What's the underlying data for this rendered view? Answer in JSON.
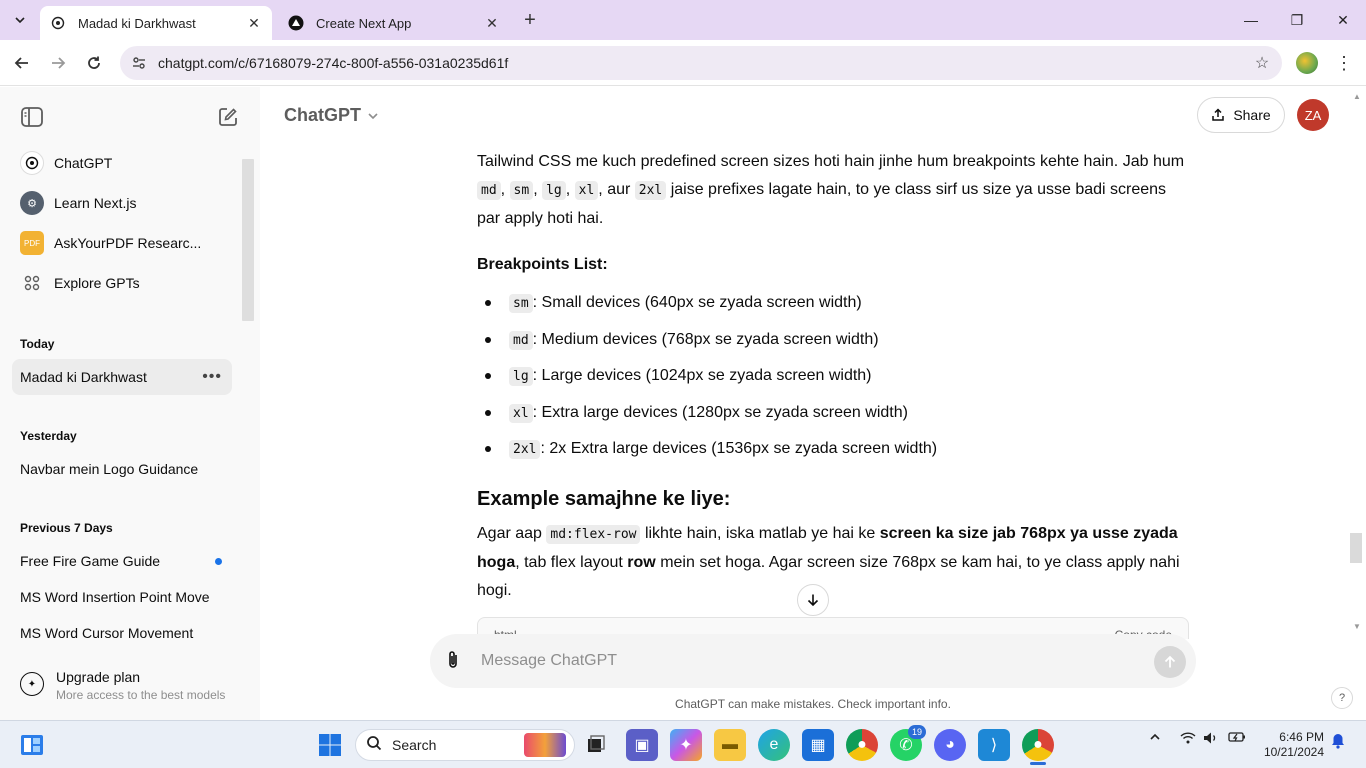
{
  "browser": {
    "tabs": [
      {
        "title": "Madad ki Darkhwast",
        "active": true
      },
      {
        "title": "Create Next App",
        "active": false
      }
    ],
    "url": "chatgpt.com/c/67168079-274c-800f-a556-031a0235d61f"
  },
  "sidebar": {
    "gpts": [
      {
        "label": "ChatGPT",
        "icon": "openai-icon"
      },
      {
        "label": "Learn Next.js",
        "icon": "nextjs-avatar"
      },
      {
        "label": "AskYourPDF Researc...",
        "icon": "askyourpdf-icon"
      },
      {
        "label": "Explore GPTs",
        "icon": "grid-icon"
      }
    ],
    "sections": [
      {
        "title": "Today",
        "items": [
          {
            "label": "Madad ki Darkhwast",
            "active": true
          }
        ]
      },
      {
        "title": "Yesterday",
        "items": [
          {
            "label": "Navbar mein Logo Guidance"
          }
        ]
      },
      {
        "title": "Previous 7 Days",
        "items": [
          {
            "label": "Free Fire Game Guide",
            "unread": true
          },
          {
            "label": "MS Word Insertion Point Move"
          },
          {
            "label": "MS Word Cursor Movement"
          }
        ]
      }
    ],
    "upgrade": {
      "title": "Upgrade plan",
      "subtitle": "More access to the best models"
    }
  },
  "header": {
    "model": "ChatGPT",
    "share_label": "Share",
    "avatar_initials": "ZA"
  },
  "message": {
    "intro_a": "Tailwind CSS me kuch predefined screen sizes hoti hain jinhe hum breakpoints kehte hain. Jab hum",
    "intro_codes": [
      "md",
      "sm",
      "lg",
      "xl",
      "2xl"
    ],
    "intro_aur": "aur",
    "intro_b": "jaise prefixes lagate hain, to ye class sirf us size ya usse badi screens par apply hoti hai.",
    "breakpoints_title": "Breakpoints List:",
    "breakpoints": [
      {
        "code": "sm",
        "text": ": Small devices (640px se zyada screen width)"
      },
      {
        "code": "md",
        "text": ": Medium devices (768px se zyada screen width)"
      },
      {
        "code": "lg",
        "text": ": Large devices (1024px se zyada screen width)"
      },
      {
        "code": "xl",
        "text": ": Extra large devices (1280px se zyada screen width)"
      },
      {
        "code": "2xl",
        "text": ": 2x Extra large devices (1536px se zyada screen width)"
      }
    ],
    "example_title": "Example samajhne ke liye:",
    "example_a": "Agar aap",
    "example_code": "md:flex-row",
    "example_b": "likhte hain, iska matlab ye hai ke",
    "example_bold1": "screen ka size jab 768px ya usse zyada hoga",
    "example_c": ", tab flex layout",
    "example_bold2": "row",
    "example_d": "mein set hoga. Agar screen size 768px se kam hai, to ye class apply nahi hogi.",
    "code_lang": "html",
    "copy_label": "Copy code"
  },
  "composer": {
    "placeholder": "Message ChatGPT",
    "value": ""
  },
  "disclaimer": "ChatGPT can make mistakes. Check important info.",
  "help_label": "?",
  "taskbar": {
    "search_label": "Search",
    "whatsapp_badge": "19",
    "time": "6:46 PM",
    "date": "10/21/2024"
  },
  "colors": {
    "accent": "#1a73e8",
    "avatar_bg": "#c0392b",
    "tabbar_bg": "#e6d8f4"
  }
}
